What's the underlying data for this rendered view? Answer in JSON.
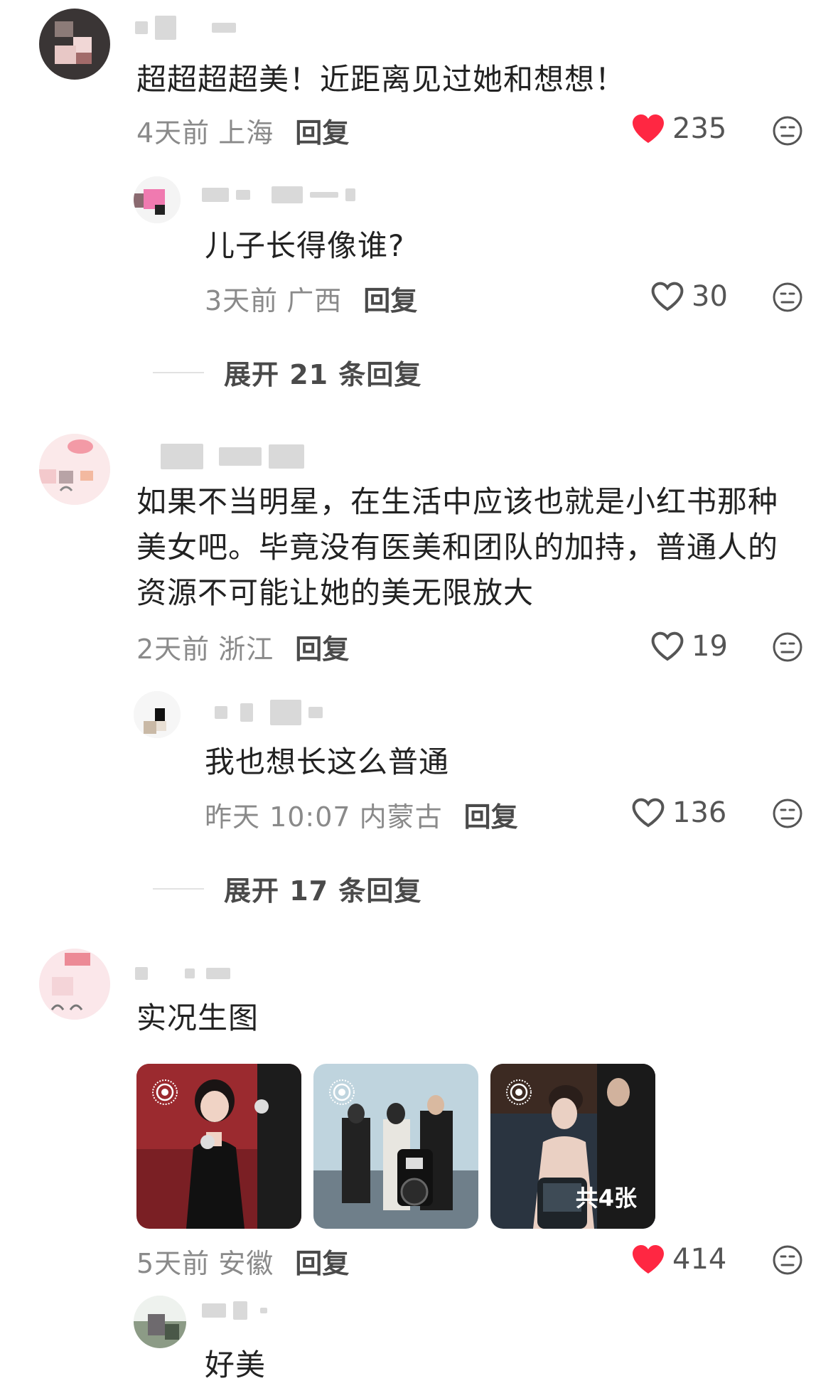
{
  "comments": [
    {
      "text": "超超超超美！近距离见过她和想想！",
      "time": "4天前",
      "location": "上海",
      "reply_label": "回复",
      "likes": "235",
      "liked": true,
      "replies": [
        {
          "text": "儿子长得像谁?",
          "time": "3天前",
          "location": "广西",
          "reply_label": "回复",
          "likes": "30",
          "liked": false
        }
      ],
      "expand_label": "展开 21 条回复"
    },
    {
      "text_lines": [
        "如果不当明星，在生活中应该也就是小红书那种",
        "美女吧。毕竟没有医美和团队的加持，普通人的",
        "资源不可能让她的美无限放大"
      ],
      "time": "2天前",
      "location": "浙江",
      "reply_label": "回复",
      "likes": "19",
      "liked": false,
      "replies": [
        {
          "text": "我也想长这么普通",
          "time": "昨天 10:07",
          "location": "内蒙古",
          "reply_label": "回复",
          "likes": "136",
          "liked": false
        }
      ],
      "expand_label": "展开 17 条回复"
    },
    {
      "text": "实况生图",
      "images_count_label": "共4张",
      "time": "5天前",
      "location": "安徽",
      "reply_label": "回复",
      "likes": "414",
      "liked": true,
      "replies": [
        {
          "text": "好美"
        }
      ]
    }
  ],
  "colors": {
    "liked_heart": "#ff2742",
    "meta_text": "#8a8a8a",
    "body_text": "#222222"
  }
}
